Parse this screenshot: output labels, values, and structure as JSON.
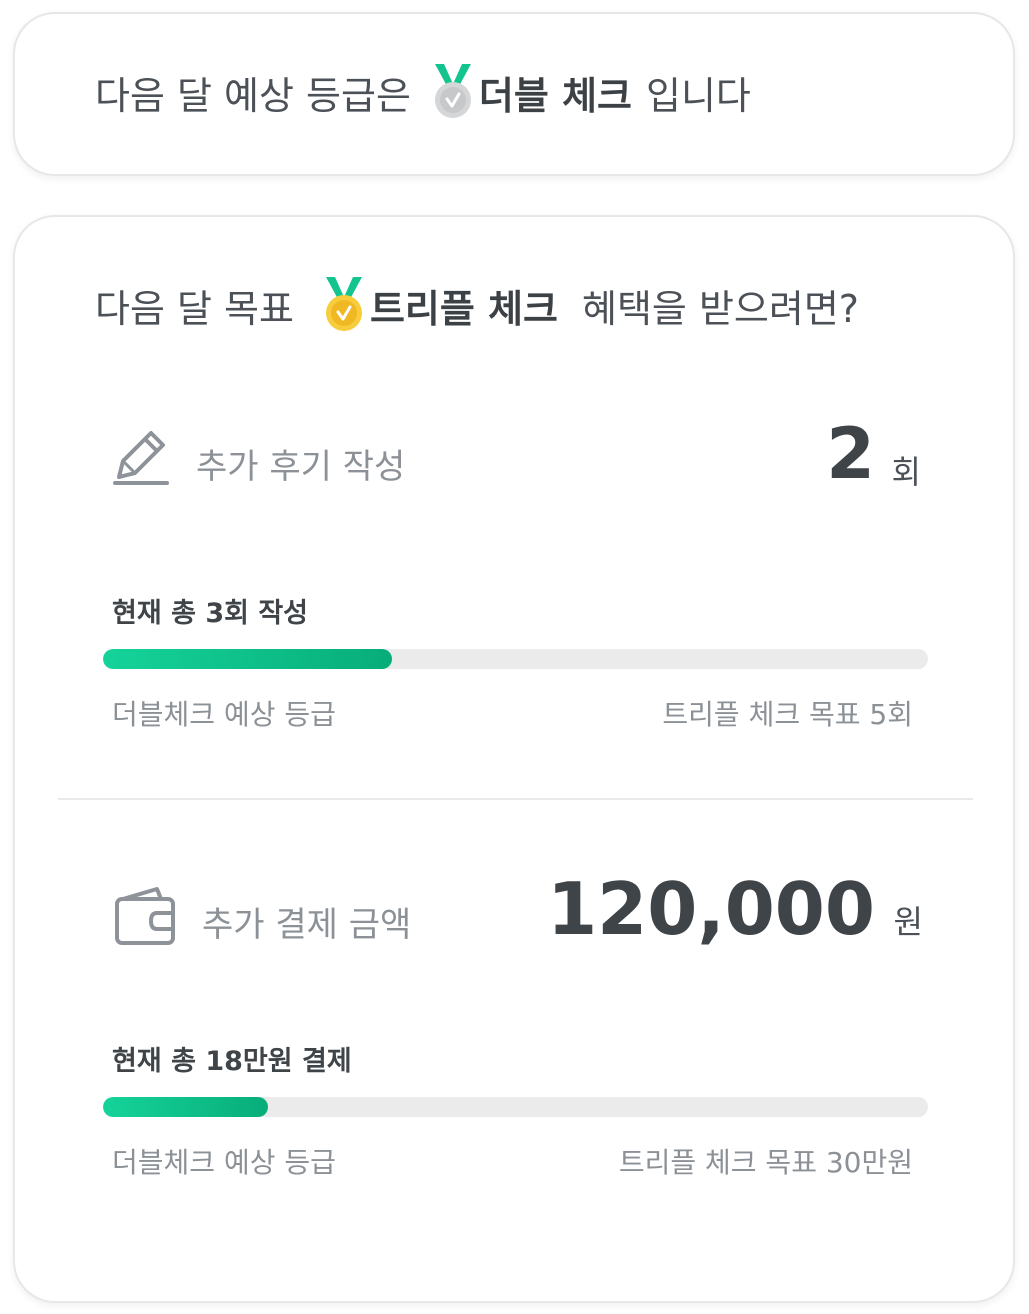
{
  "summary": {
    "prefix": "다음 달 예상 등급은",
    "grade": "더블 체크",
    "suffix": "입니다",
    "medal_icon": "silver-check-medal-icon"
  },
  "goal": {
    "prefix": "다음 달 목표",
    "grade": "트리플 체크",
    "suffix": "혜택을 받으려면?",
    "medal_icon": "gold-check-medal-icon"
  },
  "reviews": {
    "icon": "pencil-icon",
    "label": "추가 후기 작성",
    "value": "2",
    "unit": "회",
    "current_text": "현재 총 3회 작성",
    "progress": 0.35,
    "left_caption": "더블체크 예상 등급",
    "right_caption": "트리플 체크 목표 5회"
  },
  "payment": {
    "icon": "wallet-icon",
    "label": "추가 결제 금액",
    "value": "120,000",
    "unit": "원",
    "current_text": "현재 총 18만원 결제",
    "progress": 0.2,
    "left_caption": "더블체크 예상 등급",
    "right_caption": "트리플 체크 목표 30만원"
  },
  "colors": {
    "accent_start": "#15d39a",
    "accent_end": "#08ad79",
    "track": "#ebebeb",
    "gold": "#f5c332",
    "silver": "#cfd1d3"
  }
}
